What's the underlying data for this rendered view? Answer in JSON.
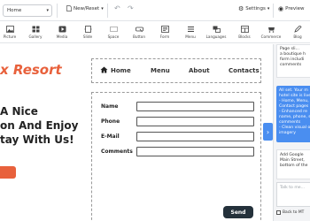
{
  "toolbar": {
    "page_select": "Home",
    "new_reset": "New/Reset",
    "settings": "Settings",
    "preview": "Preview"
  },
  "blocks": [
    {
      "label": "Picture",
      "icon": "picture-icon"
    },
    {
      "label": "Gallery",
      "icon": "gallery-icon"
    },
    {
      "label": "Media",
      "icon": "media-icon"
    },
    {
      "label": "Slide",
      "icon": "slide-icon"
    },
    {
      "label": "Space",
      "icon": "space-icon"
    },
    {
      "label": "Button",
      "icon": "button-icon"
    },
    {
      "label": "Form",
      "icon": "form-icon"
    },
    {
      "label": "Menu",
      "icon": "menu-icon"
    },
    {
      "label": "Languages",
      "icon": "languages-icon"
    },
    {
      "label": "Blocks",
      "icon": "blocks-icon"
    },
    {
      "label": "Commerce",
      "icon": "commerce-icon"
    },
    {
      "label": "Blog",
      "icon": "blog-icon"
    }
  ],
  "canvas": {
    "brand": "x Resort",
    "hero_lines": [
      "A Nice",
      "on And Enjoy",
      "tay With Us!"
    ],
    "nav": [
      "Home",
      "Menu",
      "About",
      "Contacts"
    ],
    "form": {
      "fields": [
        "Name",
        "Phone",
        "E-Mail",
        "Comments"
      ],
      "send": "Send"
    }
  },
  "chat": {
    "msg_top": "Page sli...\na boutique h\nform includi\ncomments",
    "msg_mid": "All set. Your m\nhotel site is live\n- Home, Menu,\nContact pages\n- Enhanced re\nname, phone, s\ncomments\n- Clean visual o\nimagery",
    "msg_bot": "Add Google\nMain Street,\nbottom of the",
    "placeholder": "Talk to me...",
    "back_to_mt": "Back to MT"
  },
  "colors": {
    "accent": "#e8613c",
    "chat_blue": "#4a8ef0",
    "send_button": "#24313b"
  }
}
